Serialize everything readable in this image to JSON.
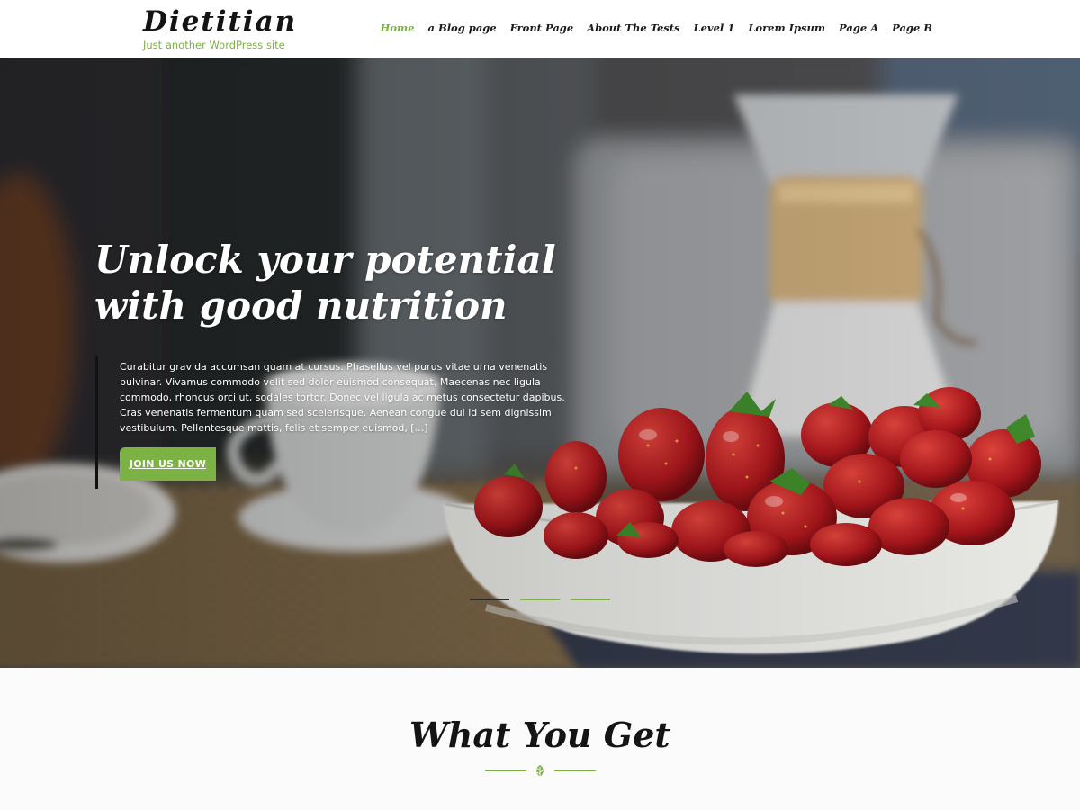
{
  "header": {
    "site_title": "Dietitian",
    "tagline": "Just another WordPress site",
    "nav": [
      {
        "label": "Home",
        "active": true
      },
      {
        "label": "a Blog page",
        "active": false
      },
      {
        "label": "Front Page",
        "active": false
      },
      {
        "label": "About The Tests",
        "active": false
      },
      {
        "label": "Level 1",
        "active": false
      },
      {
        "label": "Lorem Ipsum",
        "active": false
      },
      {
        "label": "Page A",
        "active": false
      },
      {
        "label": "Page B",
        "active": false
      }
    ]
  },
  "hero": {
    "heading": "Unlock your potential with good nutrition",
    "text": "Curabitur gravida accumsan quam at cursus. Phasellus vel purus vitae urna venenatis pulvinar. Vivamus commodo velit sed dolor euismod consequat. Maecenas nec ligula commodo, rhoncus orci ut, sodales tortor. Donec vel ligula ac metus consectetur dapibus. Cras venenatis fermentum quam sed scelerisque. Aenean congue dui id sem dignissim vestibulum. Pellentesque mattis, felis et semper euismod, [...]",
    "button_label": "JOIN US NOW",
    "image": "blurred photo of a white bowl of strawberries, a coffee cup and a glass coffee maker on a woven placemat",
    "slides": [
      {
        "active": true
      },
      {
        "active": false
      },
      {
        "active": false
      }
    ]
  },
  "features": {
    "title": "What You Get",
    "divider_icon": "leaf-icon"
  },
  "colors": {
    "accent": "#7bb243",
    "text_dark": "#141414",
    "hero_bar": "#111111"
  }
}
